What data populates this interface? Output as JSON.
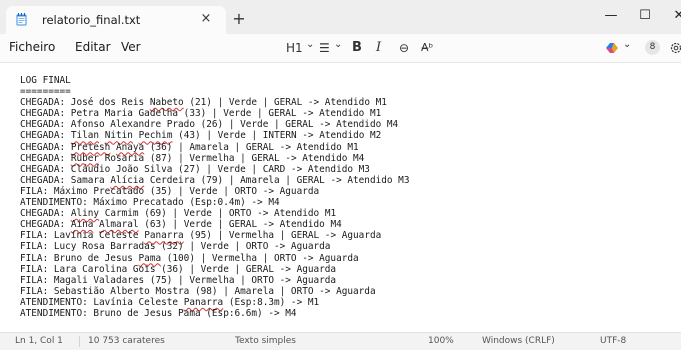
{
  "tab": {
    "title": "relatorio_final.txt",
    "close": "×",
    "new_tab": "+"
  },
  "window": {
    "minimize": "—",
    "maximize": "☐",
    "close": "✕"
  },
  "menu": {
    "file": "Ficheiro",
    "edit": "Editar",
    "view": "Ver"
  },
  "toolbar": {
    "heading": "H1",
    "heading_chevron": "⌄",
    "list": "☰",
    "list_chevron": "⌄",
    "bold": "B",
    "italic": "I",
    "link": "⊖",
    "clear": "A̶ᵇ",
    "copilot_chevron": "⌄",
    "account": "8"
  },
  "document": {
    "lines": [
      [
        {
          "t": "LOG FINAL"
        }
      ],
      [
        {
          "t": "========="
        }
      ],
      [
        {
          "t": "CHEGADA: José dos Reis "
        },
        {
          "t": "Nabeto",
          "sq": true
        },
        {
          "t": " (21) | Verde | GERAL -> Atendido M1"
        }
      ],
      [
        {
          "t": "CHEGADA: Petra Maria Gadelha (33) | Verde | GERAL -> Atendido M1"
        }
      ],
      [
        {
          "t": "CHEGADA: Afonso Alexandre Prado (26) | Verde | GERAL -> Atendido M4"
        }
      ],
      [
        {
          "t": "CHEGADA: "
        },
        {
          "t": "Tilan",
          "sq": true
        },
        {
          "t": " "
        },
        {
          "t": "Nitin",
          "sq": true
        },
        {
          "t": " "
        },
        {
          "t": "Pechim",
          "sq": true
        },
        {
          "t": " (43) | Verde | INTERN -> Atendido M2"
        }
      ],
      [
        {
          "t": "CHEGADA: "
        },
        {
          "t": "Pretesh",
          "sq": true
        },
        {
          "t": " "
        },
        {
          "t": "Anaya",
          "sq": true
        },
        {
          "t": " (36) | Amarela | GERAL -> Atendido M1"
        }
      ],
      [
        {
          "t": "CHEGADA: "
        },
        {
          "t": "Ruber",
          "sq": true
        },
        {
          "t": " Rosaria (87) | Vermelha | GERAL -> Atendido M4"
        }
      ],
      [
        {
          "t": "CHEGADA: Cláudio João Silva (27) | Verde | CARD -> Atendido M3"
        }
      ],
      [
        {
          "t": "CHEGADA: Samara "
        },
        {
          "t": "Alícia",
          "sq": true
        },
        {
          "t": " Cerdeira (79) | Amarela | GERAL -> Atendido M3"
        }
      ],
      [
        {
          "t": "FILA: Máximo Precatado (35) | Verde | ORTO -> Aguarda"
        }
      ],
      [
        {
          "t": "ATENDIMENTO: Máximo Precatado (Esp:0.4m) -> M4"
        }
      ],
      [
        {
          "t": "CHEGADA: "
        },
        {
          "t": "Aliny",
          "sq": true
        },
        {
          "t": " Carmim (69) | Verde | ORTO -> Atendido M1"
        }
      ],
      [
        {
          "t": "CHEGADA: "
        },
        {
          "t": "Aina",
          "sq": true
        },
        {
          "t": " "
        },
        {
          "t": "Almaral",
          "sq": true
        },
        {
          "t": " (63) | Verde | GERAL -> Atendido M4"
        }
      ],
      [
        {
          "t": "FILA: Lavínia Celeste "
        },
        {
          "t": "Panarra",
          "sq": true
        },
        {
          "t": " (95) | Vermelha | GERAL -> Aguarda"
        }
      ],
      [
        {
          "t": "FILA: Lucy Rosa Barradas (32) | Verde | ORTO -> Aguarda"
        }
      ],
      [
        {
          "t": "FILA: Bruno de Jesus "
        },
        {
          "t": "Pama",
          "sq": true
        },
        {
          "t": " (100) | Vermelha | ORTO -> Aguarda"
        }
      ],
      [
        {
          "t": "FILA: Lara Carolina Gois (36) | Verde | GERAL -> Aguarda"
        }
      ],
      [
        {
          "t": "FILA: Magali Valadares (75) | Vermelha | ORTO -> Aguarda"
        }
      ],
      [
        {
          "t": "FILA: Sebastião Alberto Mostra (98) | Amarela | ORTO -> Aguarda"
        }
      ],
      [
        {
          "t": "ATENDIMENTO: Lavínia Celeste "
        },
        {
          "t": "Panarra",
          "sq": true
        },
        {
          "t": " (Esp:8.3m) -> M1"
        }
      ],
      [
        {
          "t": "ATENDIMENTO: Bruno de Jesus Pama (Esp:6.6m) -> M4"
        }
      ]
    ]
  },
  "status": {
    "position": "Ln 1, Col 1",
    "chars": "10 753 carateres",
    "format": "Texto simples",
    "zoom": "100%",
    "line_ending": "Windows (CRLF)",
    "encoding": "UTF-8"
  },
  "colors": {
    "accent": "#0a5bbf",
    "squiggle": "#d13438"
  }
}
